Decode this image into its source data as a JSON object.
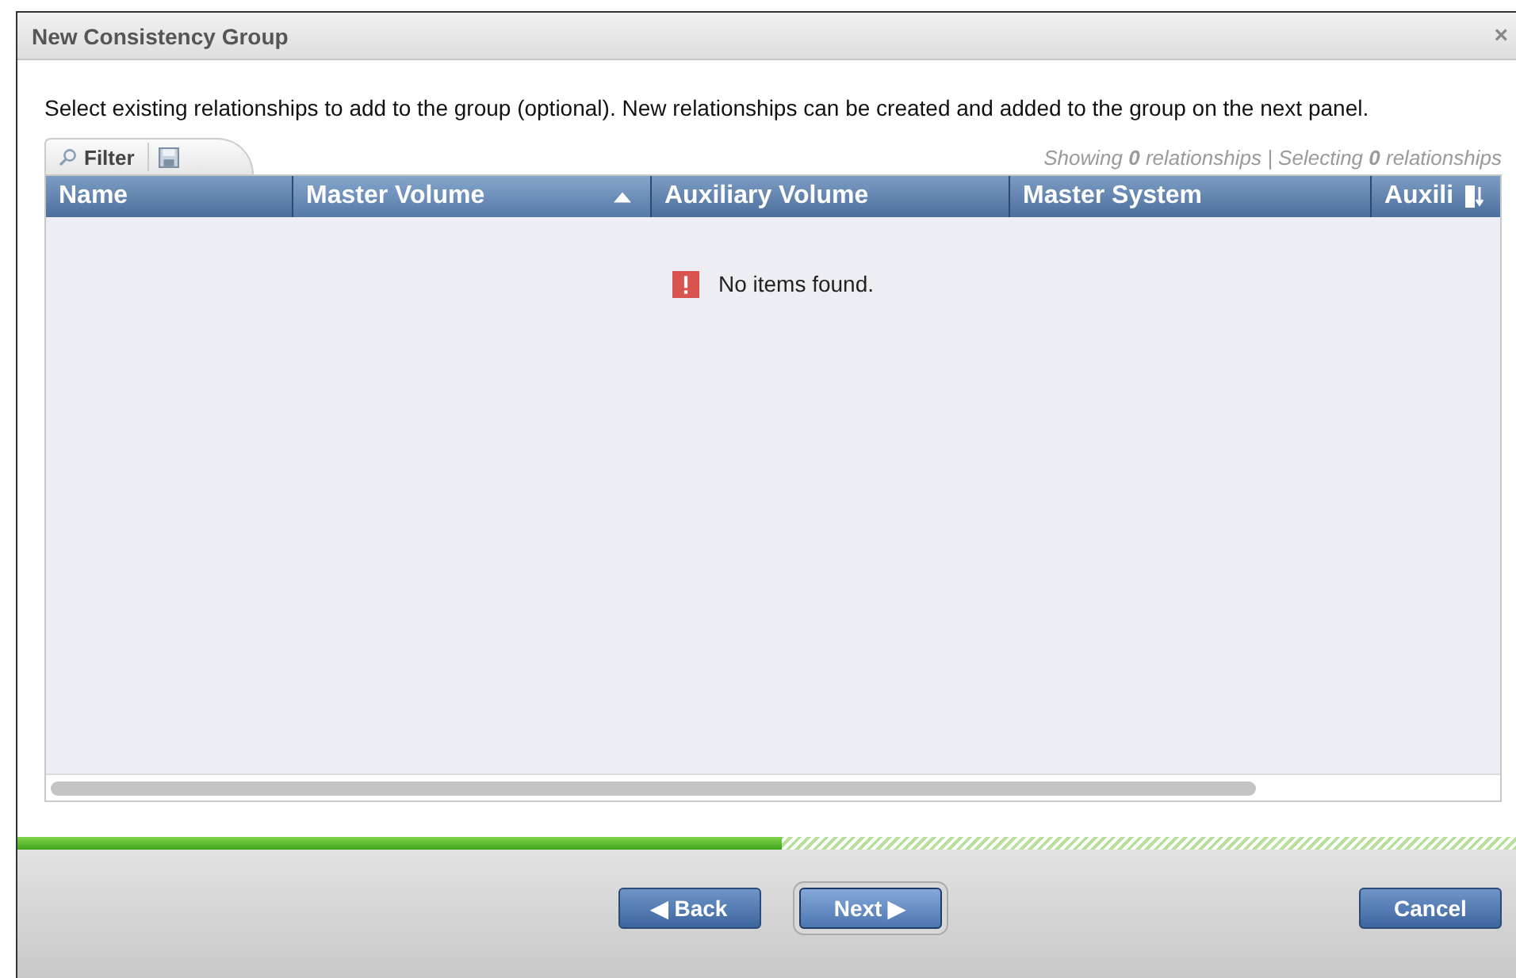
{
  "window": {
    "title": "New Consistency Group",
    "close": "×"
  },
  "instructions": "Select existing relationships to add to the group (optional). New relationships can be created and added to the group on the next panel.",
  "toolbar": {
    "filter_label": "Filter",
    "summary": "Showing **0** relationships | Selecting **0** relationships"
  },
  "table": {
    "columns": [
      {
        "label": "Name",
        "sorted": false
      },
      {
        "label": "Master Volume",
        "sorted": true
      },
      {
        "label": "Auxiliary Volume",
        "sorted": false
      },
      {
        "label": "Master System",
        "sorted": false
      },
      {
        "label": "Auxili",
        "sorted": false
      }
    ],
    "empty_message": "No items found."
  },
  "progress": {
    "level": 0.51
  },
  "buttons": [
    {
      "label": "◀ Back",
      "focused": false,
      "kind": "nav"
    },
    {
      "label": "Next ▶",
      "focused": true,
      "kind": "nav"
    },
    {
      "label": "Cancel",
      "focused": false,
      "kind": "cancel"
    }
  ]
}
